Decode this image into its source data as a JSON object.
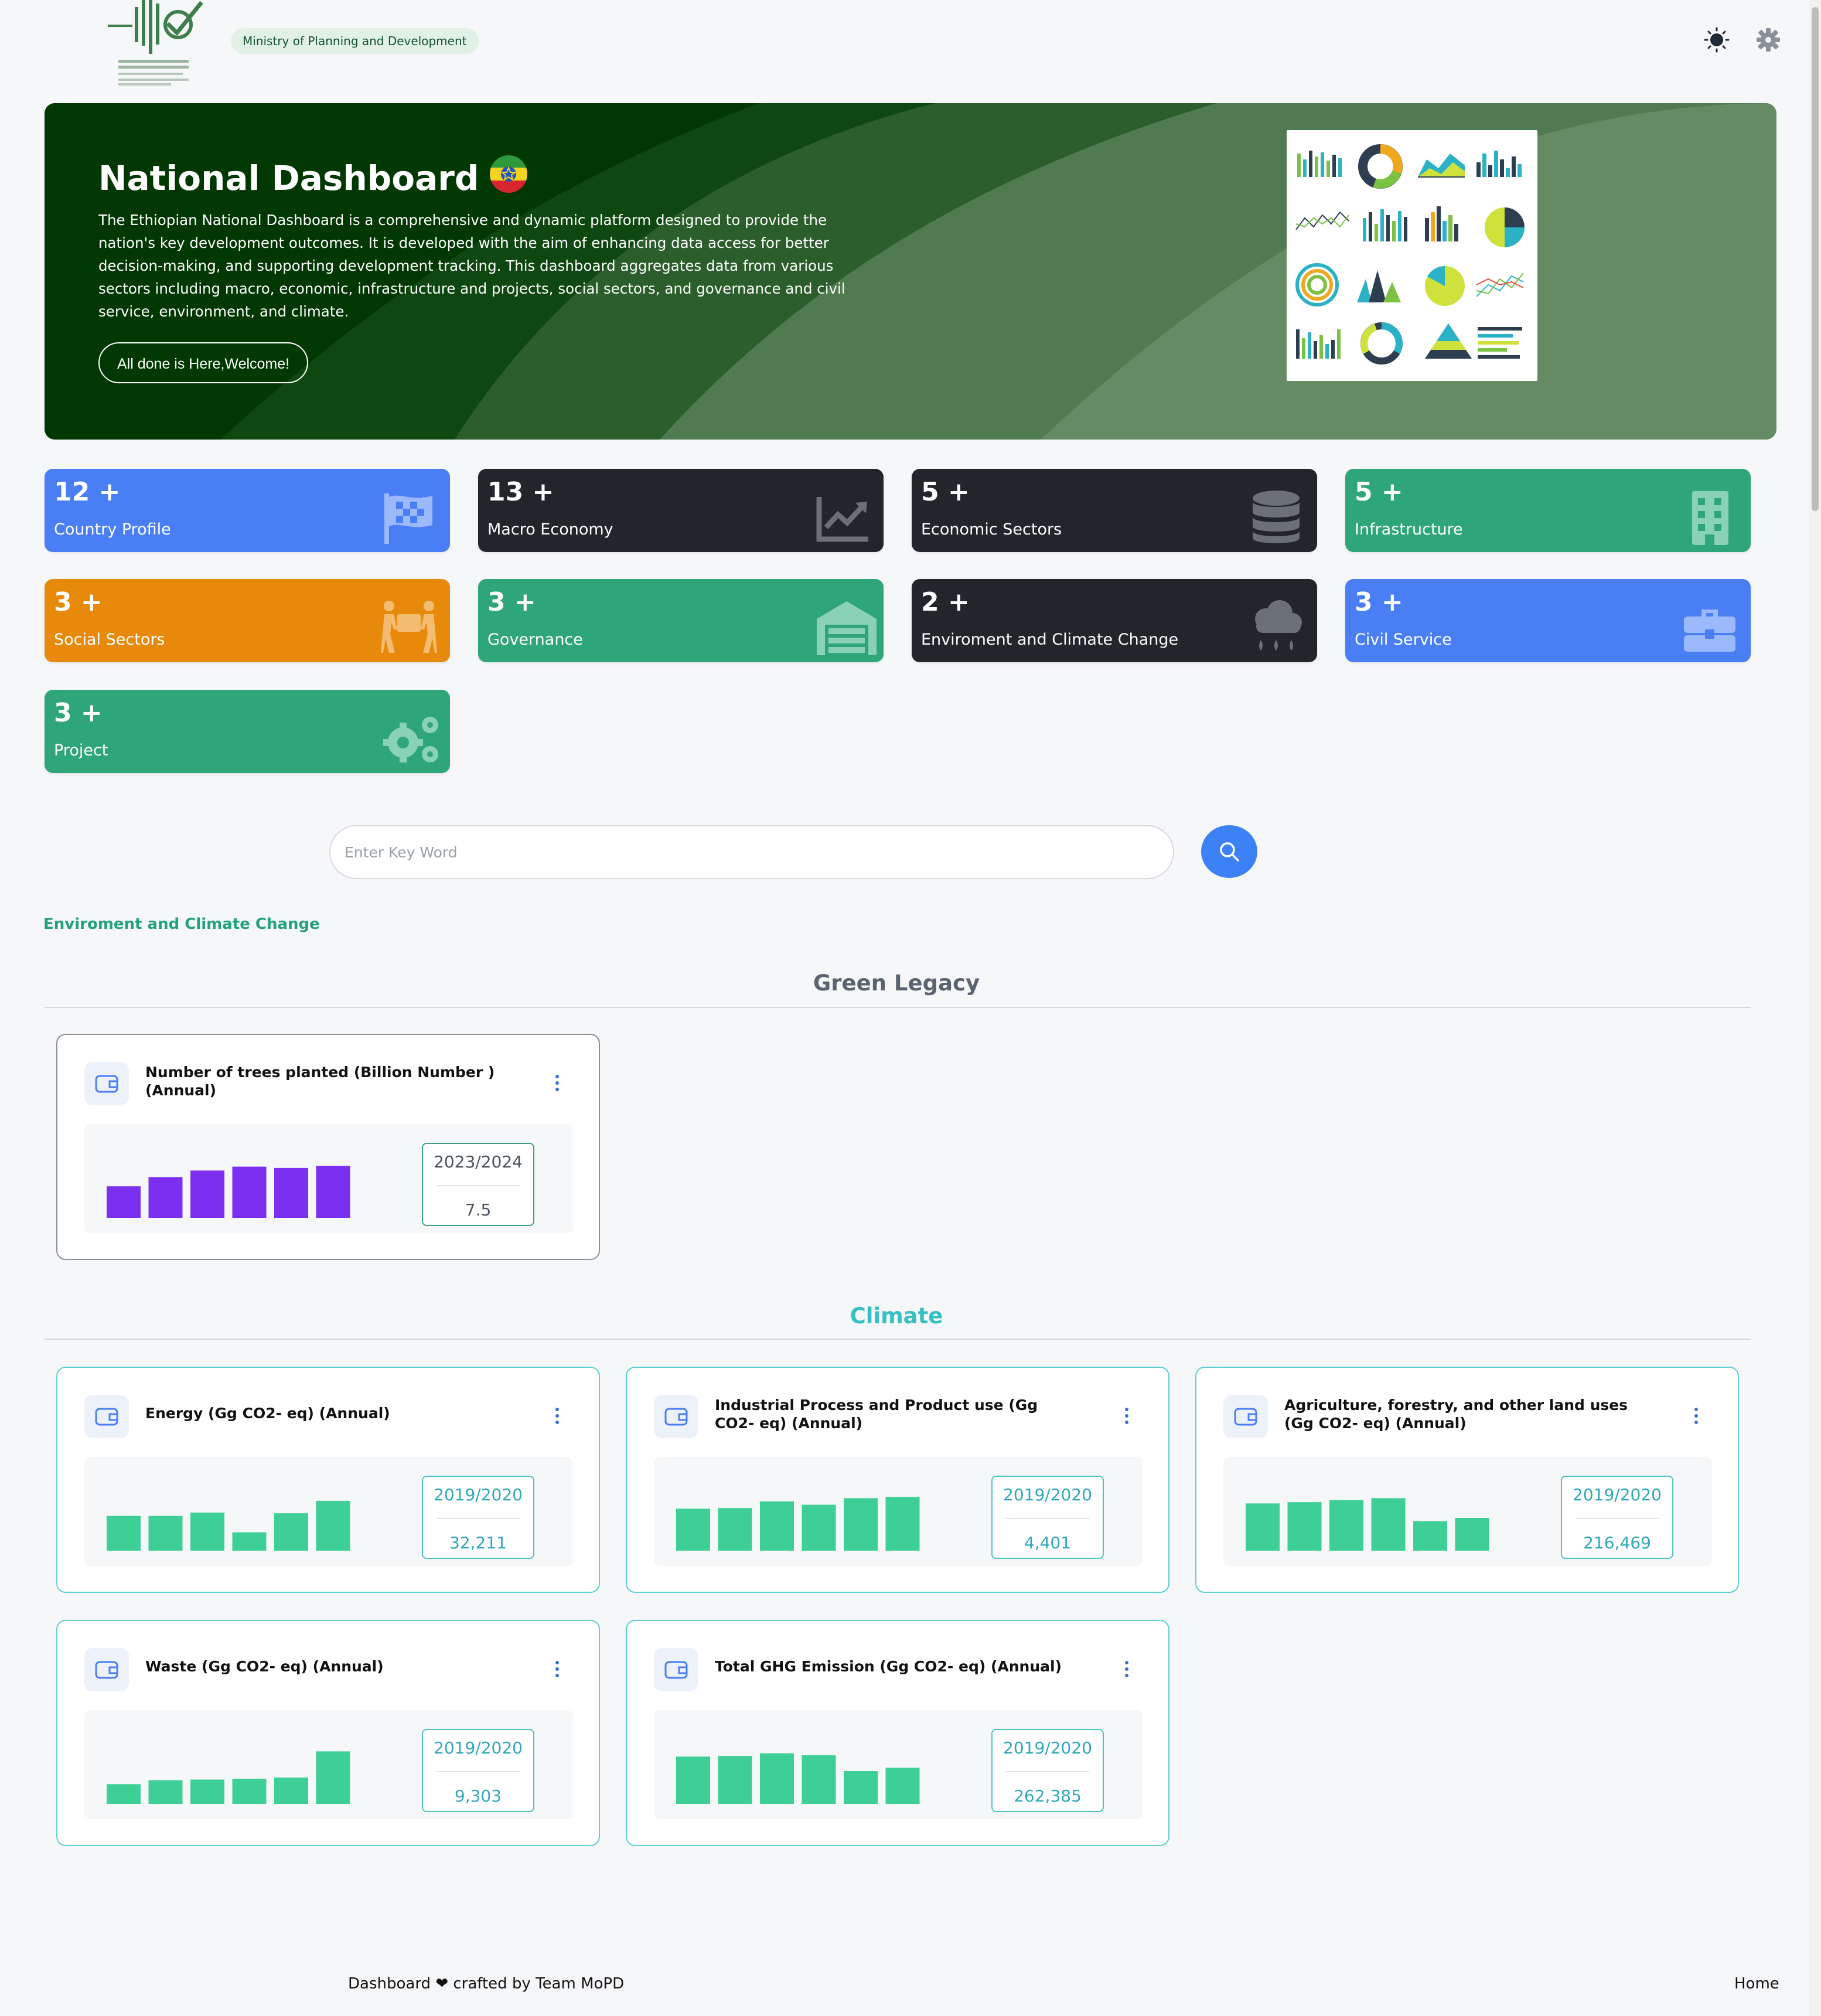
{
  "header": {
    "ministry_label": "Ministry of Planning and Development",
    "icons": [
      "logo-emblem",
      "sun-icon",
      "gear-icon"
    ]
  },
  "hero": {
    "title": "National Dashboard",
    "description": "The Ethiopian National Dashboard is a comprehensive and dynamic platform designed to provide the nation's key development outcomes. It is developed with the aim of enhancing data access for better decision-making, and supporting development tracking. This dashboard aggregates data from various sectors including macro, economic, infrastructure and projects, social sectors, and governance and civil service, environment, and climate.",
    "button_label": "All done is Here,Welcome!"
  },
  "categories": [
    {
      "count": "12 +",
      "label": "Country Profile",
      "icon": "flag-icon",
      "color": "#4a7ef5"
    },
    {
      "count": "13 +",
      "label": "Macro Economy",
      "icon": "trend-chart-icon",
      "color": "#22252a"
    },
    {
      "count": "5 +",
      "label": "Economic Sectors",
      "icon": "database-icon",
      "color": "#22252a"
    },
    {
      "count": "5 +",
      "label": "Infrastructure",
      "icon": "building-icon",
      "color": "#2fa67a"
    },
    {
      "count": "3 +",
      "label": "Social Sectors",
      "icon": "people-carry-icon",
      "color": "#e78a0c"
    },
    {
      "count": "3 +",
      "label": "Governance",
      "icon": "warehouse-icon",
      "color": "#2fa67a"
    },
    {
      "count": "2 +",
      "label": "Enviroment and Climate Change",
      "icon": "cloud-rain-icon",
      "color": "#22252a"
    },
    {
      "count": "3 +",
      "label": "Civil Service",
      "icon": "briefcase-icon",
      "color": "#4a7ef5"
    },
    {
      "count": "3 +",
      "label": "Project",
      "icon": "gears-icon",
      "color": "#2fa67a"
    }
  ],
  "search": {
    "placeholder": "Enter Key Word",
    "value": ""
  },
  "breadcrumb": "Enviroment and Climate Change",
  "sections": [
    {
      "title": "Green Legacy",
      "title_color": "#5a6470",
      "cards": [
        {
          "title": "Number of trees planted (Billion Number ) (Annual)",
          "period": "2023/2024",
          "value": "7.5",
          "bars": [
            0.48,
            0.62,
            0.72,
            0.78,
            0.76,
            0.79
          ],
          "bar_color": "#7b2ff0"
        }
      ]
    },
    {
      "title": "Climate",
      "title_color": "#36bfc4",
      "cards": [
        {
          "title": "Energy (Gg CO2- eq) (Annual)",
          "period": "2019/2020",
          "value": "32,211",
          "bars": [
            0.53,
            0.53,
            0.58,
            0.28,
            0.57,
            0.76
          ],
          "bar_color": "#3ecf97"
        },
        {
          "title": "Industrial Process and Product use (Gg CO2- eq) (Annual)",
          "period": "2019/2020",
          "value": "4,401",
          "bars": [
            0.64,
            0.65,
            0.75,
            0.7,
            0.8,
            0.82
          ],
          "bar_color": "#3ecf97"
        },
        {
          "title": "Agriculture, forestry, and other land uses (Gg CO2- eq) (Annual)",
          "period": "2019/2020",
          "value": "216,469",
          "bars": [
            0.72,
            0.74,
            0.77,
            0.8,
            0.45,
            0.5
          ],
          "bar_color": "#3ecf97"
        },
        {
          "title": "Waste (Gg CO2- eq) (Annual)",
          "period": "2019/2020",
          "value": "9,303",
          "bars": [
            0.3,
            0.36,
            0.37,
            0.38,
            0.4,
            0.8
          ],
          "bar_color": "#3ecf97"
        },
        {
          "title": "Total GHG Emission (Gg CO2- eq) (Annual)",
          "period": "2019/2020",
          "value": "262,385",
          "bars": [
            0.72,
            0.73,
            0.77,
            0.74,
            0.5,
            0.55
          ],
          "bar_color": "#3ecf97"
        }
      ]
    }
  ],
  "footer": {
    "credit": "Dashboard ❤ crafted by Team MoPD",
    "home_link": "Home"
  }
}
